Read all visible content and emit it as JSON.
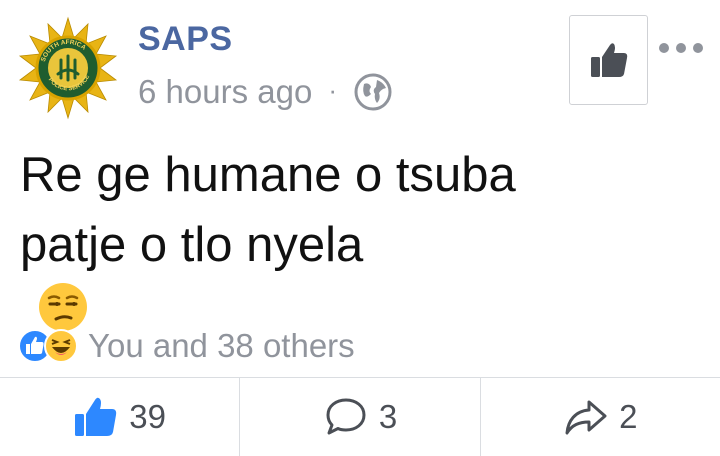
{
  "post": {
    "page_name": "SAPS",
    "timestamp": "6 hours ago",
    "separator": "·",
    "privacy_icon": "globe-icon",
    "text_line1": "Re ge humane o tsuba",
    "text_line2": "patje o tlo nyela",
    "inline_emoji": "unamused-face-emoji",
    "logo_text": "SOUTH AFRICA · POLICE SERVICE"
  },
  "header_actions": {
    "like_page_icon": "thumbs-up-icon",
    "more_icon": "more-options-icon"
  },
  "reactions": {
    "icons": [
      "like-reaction-icon",
      "haha-reaction-icon"
    ],
    "summary": "You and 38 others"
  },
  "actions": {
    "like_count": "39",
    "comment_count": "3",
    "share_count": "2"
  },
  "colors": {
    "brand_blue": "#4b67a1",
    "like_blue": "#2d88ff",
    "meta_gray": "#90949c",
    "icon_gray": "#4b4f56",
    "emoji_yellow": "#ffc83d"
  }
}
